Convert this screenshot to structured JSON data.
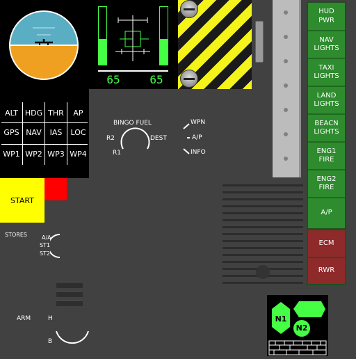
{
  "gauge": {
    "left_value": "65",
    "right_value": "65",
    "left_level": 0.45,
    "right_level": 0.45
  },
  "nav_grid": [
    [
      "ALT",
      "HDG",
      "THR",
      "AP"
    ],
    [
      "GPS",
      "NAV",
      "IAS",
      "LOC"
    ],
    [
      "WP1",
      "WP2",
      "WP3",
      "WP4"
    ]
  ],
  "knob_mode": {
    "title": "BINGO FUEL",
    "left_top": "R2",
    "left_bottom": "R1",
    "right": "DEST"
  },
  "selector": {
    "items": [
      "WPN",
      "A/P",
      "INFO"
    ]
  },
  "start_button": {
    "label": "START"
  },
  "stores": {
    "label": "STORES",
    "items": [
      "A/A",
      "ST1",
      "ST2"
    ]
  },
  "arm": {
    "label": "ARM",
    "high": "H",
    "bottom": "B"
  },
  "switches": [
    "HUD PWR",
    "NAV LIGHTS",
    "TAXI LIGHTS",
    "LAND LIGHTS",
    "BEACN LIGHTS",
    "ENG1 FIRE",
    "ENG2 FIRE",
    "A/P"
  ],
  "warnings": [
    "ECM",
    "RWR"
  ],
  "engine": {
    "n1": "N1",
    "n2": "N2"
  },
  "colors": {
    "panel": "#414141",
    "switch_green": "#2e8b2e",
    "warning_red": "#8e2a2a",
    "hud_green": "#44ff44",
    "start_yellow": "#ffff00",
    "sky": "#5aaec4",
    "ground": "#f0a020"
  }
}
